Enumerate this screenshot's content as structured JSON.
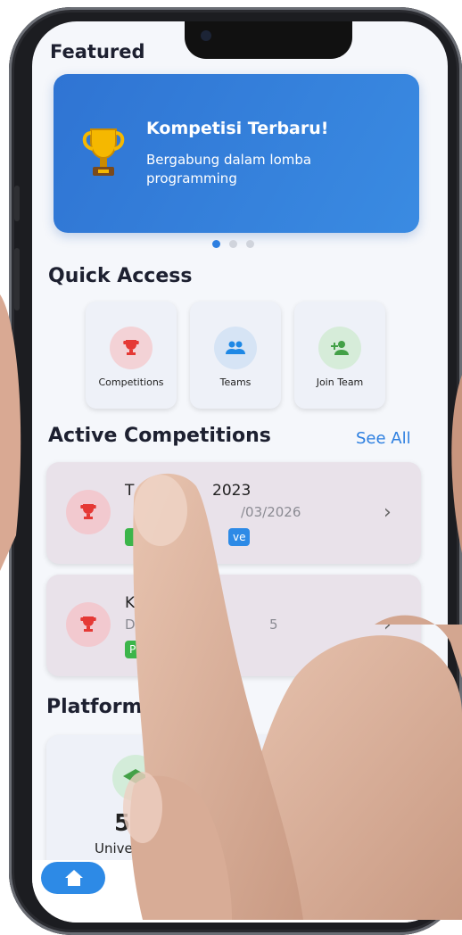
{
  "featured": {
    "title": "Featured",
    "banner_title": "Kompetisi Terbaru!",
    "banner_subtitle": "Bergabung dalam lomba programming",
    "banner_icon": "trophy-icon"
  },
  "quick_access": {
    "title": "Quick Access",
    "items": [
      {
        "label": "Competitions",
        "icon": "trophy-icon",
        "color": "#e53935"
      },
      {
        "label": "Teams",
        "icon": "group-icon",
        "color": "#1e88e5"
      },
      {
        "label": "Join Team",
        "icon": "person-add-icon",
        "color": "#43a047"
      }
    ]
  },
  "active_competitions": {
    "title": "Active Competitions",
    "see_all": "See All",
    "items": [
      {
        "title_start": "T",
        "title_end": "2023",
        "subtitle": "/03/2026",
        "badge_left": "",
        "badge_right": "ve"
      },
      {
        "title": "KM",
        "subtitle_start": "Deac",
        "subtitle_end": "5",
        "badge": "Publis"
      }
    ]
  },
  "platform_stats": {
    "title": "Platform Sta",
    "value": "5",
    "label": "Univers"
  },
  "colors": {
    "primary": "#2d7fe0",
    "banner": "#3a8be2",
    "success": "#3cb54a"
  },
  "nav": {
    "home_icon": "home-icon"
  }
}
